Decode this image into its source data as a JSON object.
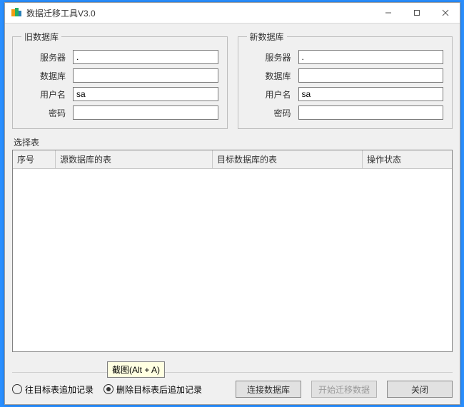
{
  "titlebar": {
    "title": "数据迁移工具V3.0"
  },
  "oldDb": {
    "legend": "旧数据库",
    "serverLabel": "服务器",
    "serverValue": ".",
    "databaseLabel": "数据库",
    "databaseValue": "",
    "userLabel": "用户名",
    "userValue": "sa",
    "passwordLabel": "密码",
    "passwordValue": ""
  },
  "newDb": {
    "legend": "新数据库",
    "serverLabel": "服务器",
    "serverValue": ".",
    "databaseLabel": "数据库",
    "databaseValue": "",
    "userLabel": "用户名",
    "userValue": "sa",
    "passwordLabel": "密码",
    "passwordValue": ""
  },
  "selectTable": {
    "title": "选择表",
    "columns": {
      "seq": "序号",
      "srcTable": "源数据库的表",
      "dstTable": "目标数据库的表",
      "status": "操作状态"
    },
    "rows": []
  },
  "tooltip": "截图(Alt + A)",
  "options": {
    "append": "往目标表追加记录",
    "replace": "删除目标表后追加记录",
    "selected": "replace"
  },
  "buttons": {
    "connect": "连接数据库",
    "start": "开始迁移数据",
    "close": "关闭"
  }
}
